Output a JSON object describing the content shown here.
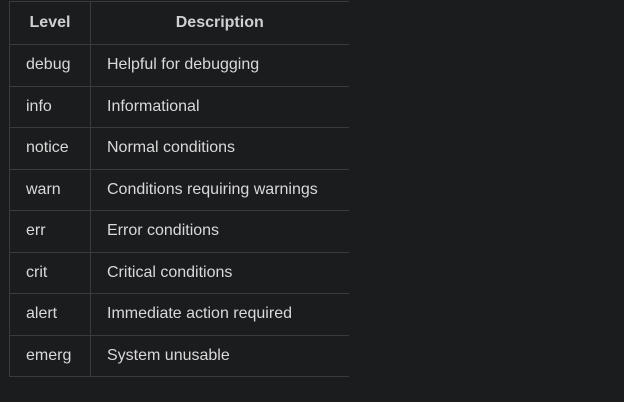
{
  "table": {
    "headers": {
      "level": "Level",
      "description": "Description"
    },
    "rows": [
      {
        "level": "debug",
        "description": "Helpful for debugging"
      },
      {
        "level": "info",
        "description": "Informational"
      },
      {
        "level": "notice",
        "description": "Normal conditions"
      },
      {
        "level": "warn",
        "description": "Conditions requiring warnings"
      },
      {
        "level": "err",
        "description": "Error conditions"
      },
      {
        "level": "crit",
        "description": "Critical conditions"
      },
      {
        "level": "alert",
        "description": "Immediate action required"
      },
      {
        "level": "emerg",
        "description": "System unusable"
      }
    ]
  },
  "colors": {
    "background": "#1b1c1e",
    "border": "#3a3b3f",
    "text": "#d9d9d9"
  }
}
